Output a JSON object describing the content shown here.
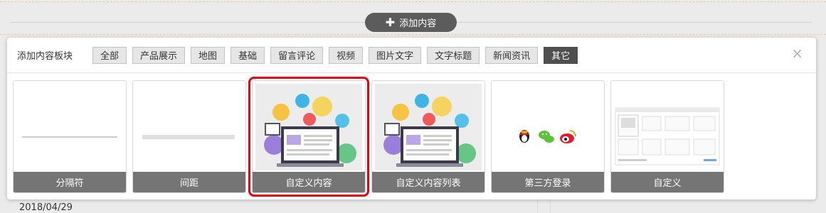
{
  "add_button": {
    "icon": "plus-icon",
    "label": "添加内容"
  },
  "background": {
    "date": "2018/04/29"
  },
  "panel": {
    "title": "添加内容板块",
    "filters": [
      "全部",
      "产品展示",
      "地图",
      "基础",
      "留言评论",
      "视频",
      "图片文字",
      "文字标题",
      "新闻资讯",
      "其它"
    ],
    "active_filter": "其它",
    "close_icon": "×",
    "cards": [
      {
        "label": "分隔符",
        "thumb": "separator-line"
      },
      {
        "label": "间距",
        "thumb": "spacing-bar"
      },
      {
        "label": "自定义内容",
        "thumb": "laptop-illustration",
        "selected": true
      },
      {
        "label": "自定义内容列表",
        "thumb": "laptop-illustration"
      },
      {
        "label": "第三方登录",
        "thumb": "social-icons"
      },
      {
        "label": "自定义",
        "thumb": "custom-layout-preview"
      }
    ]
  },
  "colors": {
    "selected_outline": "#e60012",
    "active_filter_bg": "#4f4f4f",
    "card_label_bg": "#757575"
  }
}
